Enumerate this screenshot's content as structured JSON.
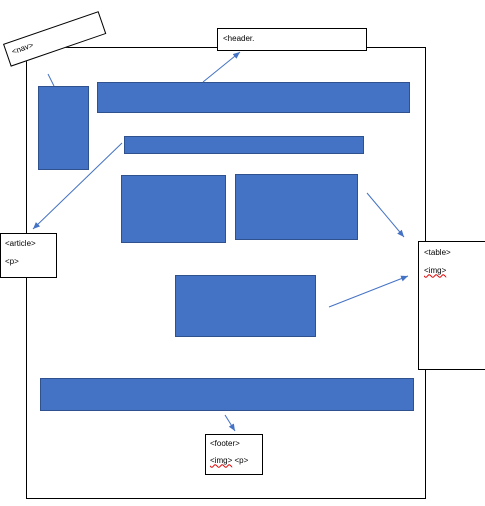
{
  "colors": {
    "block_fill": "#4472c4",
    "block_border": "#2f528f",
    "arrow": "#4472c4",
    "spellcheck_underline": "#e00000"
  },
  "labels": {
    "nav": "<nav>",
    "header": "<header.",
    "article_line1": "<article>",
    "article_line2": "<p>",
    "table_line1": "<table>",
    "table_line2": "<img>",
    "footer_line1": "<footer>",
    "footer_line2_img": "<img>",
    "footer_line2_p": " <p>"
  }
}
